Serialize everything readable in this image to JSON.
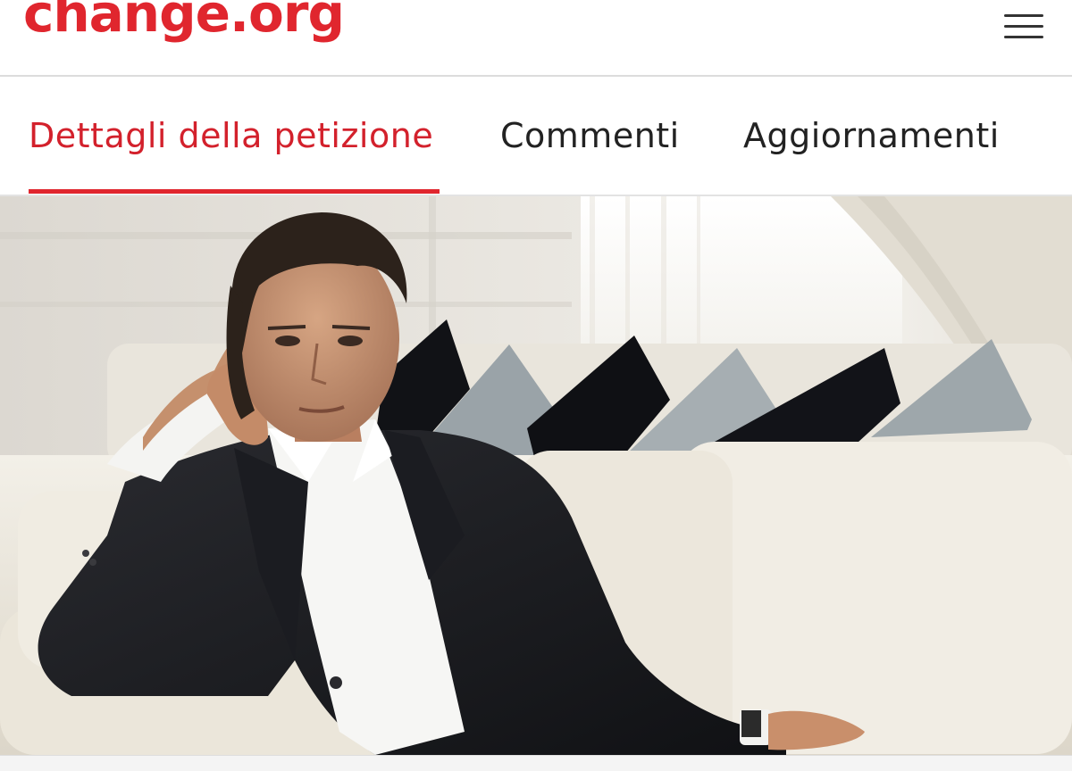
{
  "header": {
    "logo_text": "change.org",
    "menu_icon": "hamburger-menu-icon"
  },
  "tabs": [
    {
      "label": "Dettagli della petizione",
      "active": true
    },
    {
      "label": "Commenti",
      "active": false
    },
    {
      "label": "Aggiornamenti",
      "active": false
    }
  ],
  "colors": {
    "brand": "#e0262e",
    "active_tab": "#d3212c",
    "text": "#222222"
  },
  "hero": {
    "image": "photo of a man in a black suit sitting on a white sofa"
  }
}
